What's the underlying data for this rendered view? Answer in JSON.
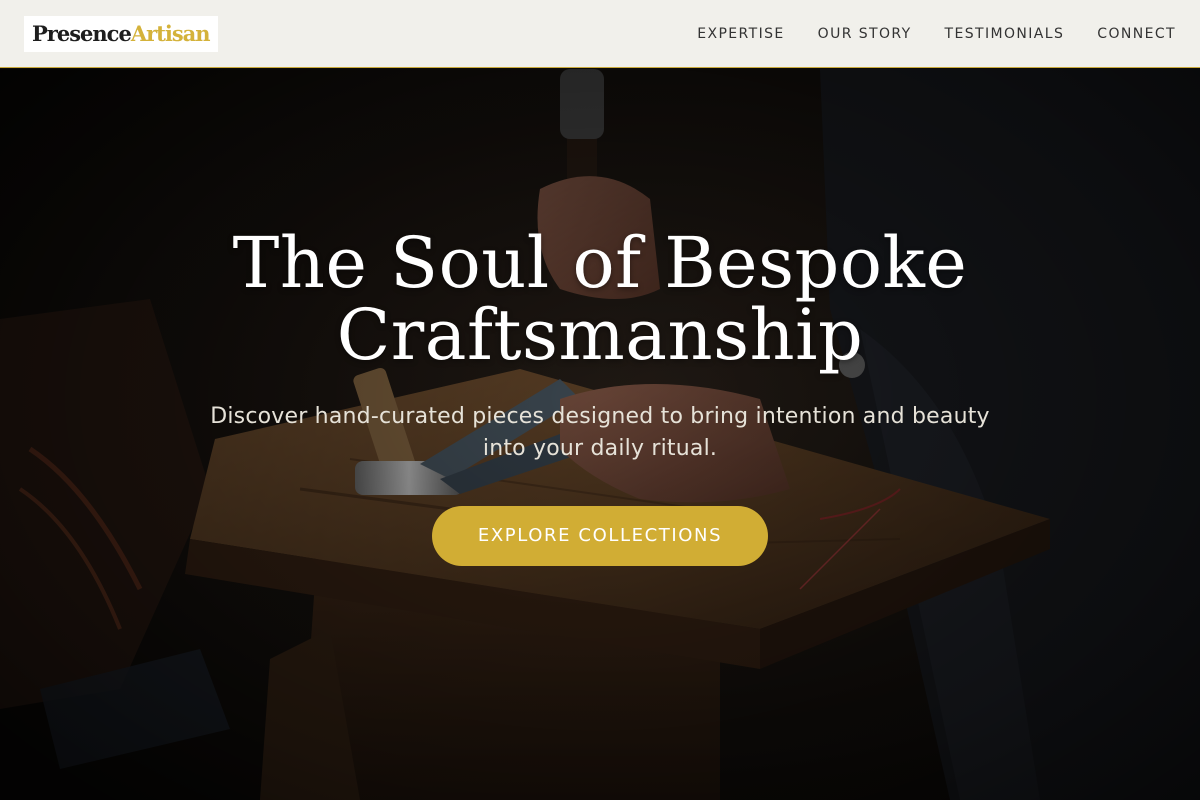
{
  "brand": {
    "name_part1": "Presence",
    "name_part2": "Artisan",
    "accent_color": "#d1ad34"
  },
  "nav": {
    "items": [
      {
        "label": "EXPERTISE"
      },
      {
        "label": "OUR STORY"
      },
      {
        "label": "TESTIMONIALS"
      },
      {
        "label": "CONNECT"
      }
    ]
  },
  "hero": {
    "title_line1": "The Soul of Bespoke",
    "title_line2": "Craftsmanship",
    "subtitle_line1": "Discover hand-curated pieces designed to bring intention and beauty",
    "subtitle_line2": "into your daily ritual.",
    "cta_label": "EXPLORE COLLECTIONS",
    "background": "dark workshop photo: hands holding hammer over worn wooden workbench with tools"
  }
}
